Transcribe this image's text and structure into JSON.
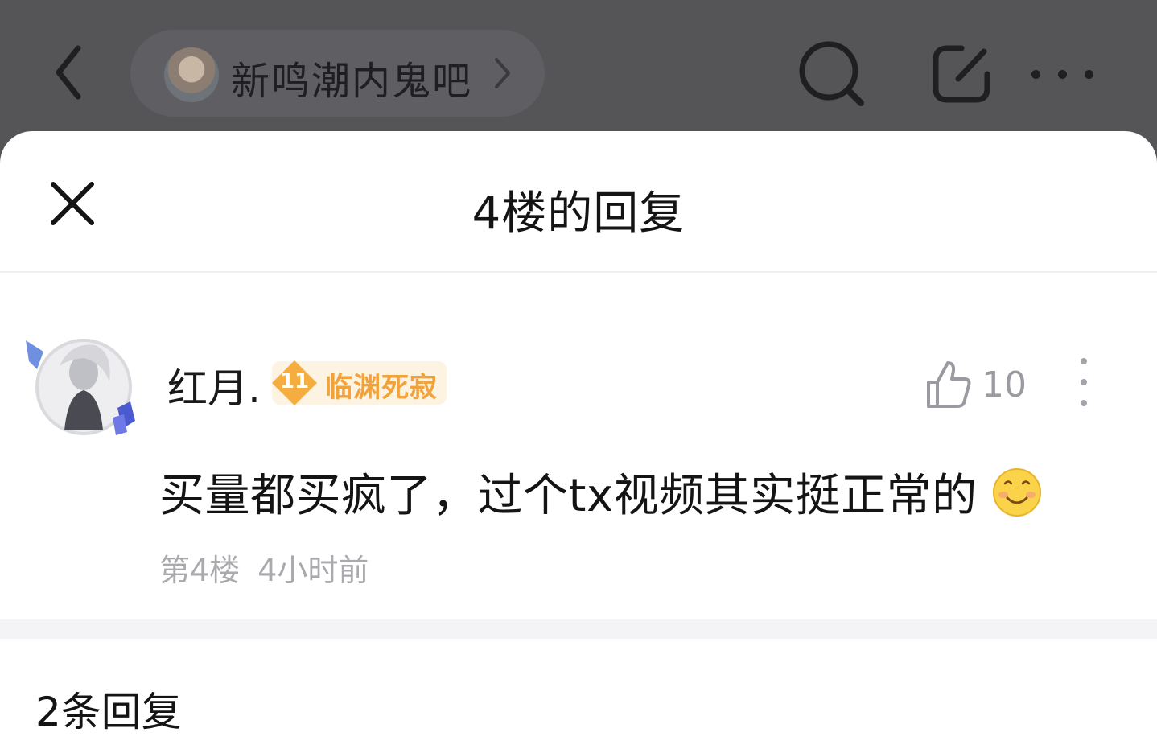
{
  "topbar": {
    "forum_name": "新鸣潮内鬼吧",
    "icons": [
      "back-icon",
      "chevron-right-icon",
      "search-icon",
      "edit-icon",
      "more-icon"
    ]
  },
  "sheet": {
    "title": "4楼的回复",
    "close_icon": "close-icon"
  },
  "post": {
    "username": "红月.",
    "level": "11",
    "level_title": "临渊死寂",
    "likes": "10",
    "content": "买量都买疯了，过个tx视频其实挺正常的",
    "emoji": "smile-emoji",
    "floor": "第4楼",
    "time": "4小时前"
  },
  "replies": {
    "count_label": "2条回复"
  },
  "colors": {
    "overlay": "#555558",
    "badge_bg": "#fdf3e2",
    "badge_accent": "#f2a23a",
    "meta_gray": "#a9a9ae",
    "text": "#141414"
  }
}
